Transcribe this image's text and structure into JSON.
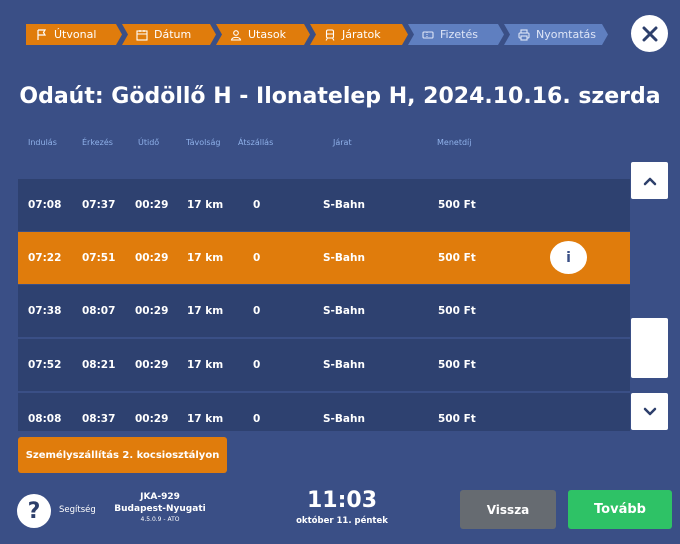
{
  "colors": {
    "done_step": "#e07c0c",
    "todo_step": "#5f7fc0",
    "background": "#3a4f86",
    "row": "#2e4170",
    "selected_row": "#e07c0c",
    "next": "#2ec266",
    "back": "#666b71"
  },
  "steps": [
    {
      "label": "Útvonal",
      "icon": "flag-icon",
      "status": "done"
    },
    {
      "label": "Dátum",
      "icon": "calendar-icon",
      "status": "done"
    },
    {
      "label": "Utasok",
      "icon": "person-icon",
      "status": "done"
    },
    {
      "label": "Járatok",
      "icon": "train-icon",
      "status": "done"
    },
    {
      "label": "Fizetés",
      "icon": "ticket-icon",
      "status": "todo"
    },
    {
      "label": "Nyomtatás",
      "icon": "printer-icon",
      "status": "todo"
    }
  ],
  "close_icon": "close-icon",
  "title": "Odaút: Gödöllő H - Ilonatelep H, 2024.10.16. szerda",
  "table": {
    "headers": {
      "departure": "Indulás",
      "arrival": "Érkezés",
      "duration": "Útidő",
      "distance": "Távolság",
      "transfers": "Átszállás",
      "service": "Járat",
      "fare": "Menetdíj"
    },
    "rows": [
      {
        "departure": "07:08",
        "arrival": "07:37",
        "duration": "00:29",
        "distance": "17 km",
        "transfers": "0",
        "service": "S-Bahn",
        "fare": "500 Ft"
      },
      {
        "departure": "07:22",
        "arrival": "07:51",
        "duration": "00:29",
        "distance": "17 km",
        "transfers": "0",
        "service": "S-Bahn",
        "fare": "500 Ft",
        "info": "i"
      },
      {
        "departure": "07:38",
        "arrival": "08:07",
        "duration": "00:29",
        "distance": "17 km",
        "transfers": "0",
        "service": "S-Bahn",
        "fare": "500 Ft"
      },
      {
        "departure": "07:52",
        "arrival": "08:21",
        "duration": "00:29",
        "distance": "17 km",
        "transfers": "0",
        "service": "S-Bahn",
        "fare": "500 Ft"
      },
      {
        "departure": "08:08",
        "arrival": "08:37",
        "duration": "00:29",
        "distance": "17 km",
        "transfers": "0",
        "service": "S-Bahn",
        "fare": "500 Ft"
      }
    ]
  },
  "class_button": "Személyszállítás 2. kocsiosztályon",
  "help": {
    "icon": "?",
    "label": "Segítség"
  },
  "kiosk": {
    "id": "JKA-929",
    "station": "Budapest-Nyugati",
    "version": "4.5.0.9 - ATO"
  },
  "clock": {
    "time": "11:03",
    "date": "október 11. péntek"
  },
  "buttons": {
    "back": "Vissza",
    "next": "Tovább"
  }
}
